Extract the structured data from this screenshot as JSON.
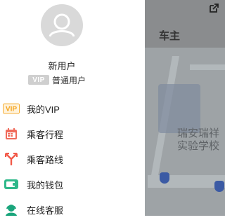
{
  "background": {
    "title": "车主",
    "map_label": "瑞安瑞祥实验学校"
  },
  "profile": {
    "username": "新用户",
    "vip_tag": "VIP",
    "level": "普通用户"
  },
  "menu": {
    "items": [
      {
        "label": "我的VIP",
        "icon": "vip-icon"
      },
      {
        "label": "乘客行程",
        "icon": "calendar-icon"
      },
      {
        "label": "乘客路线",
        "icon": "route-icon"
      },
      {
        "label": "我的钱包",
        "icon": "wallet-icon"
      },
      {
        "label": "在线客服",
        "icon": "customer-service-icon"
      }
    ]
  },
  "colors": {
    "vip": "#f5a623",
    "calendar": "#f06b5b",
    "route": "#f25a4a",
    "wallet": "#2eb88a",
    "service": "#1aa57c"
  }
}
